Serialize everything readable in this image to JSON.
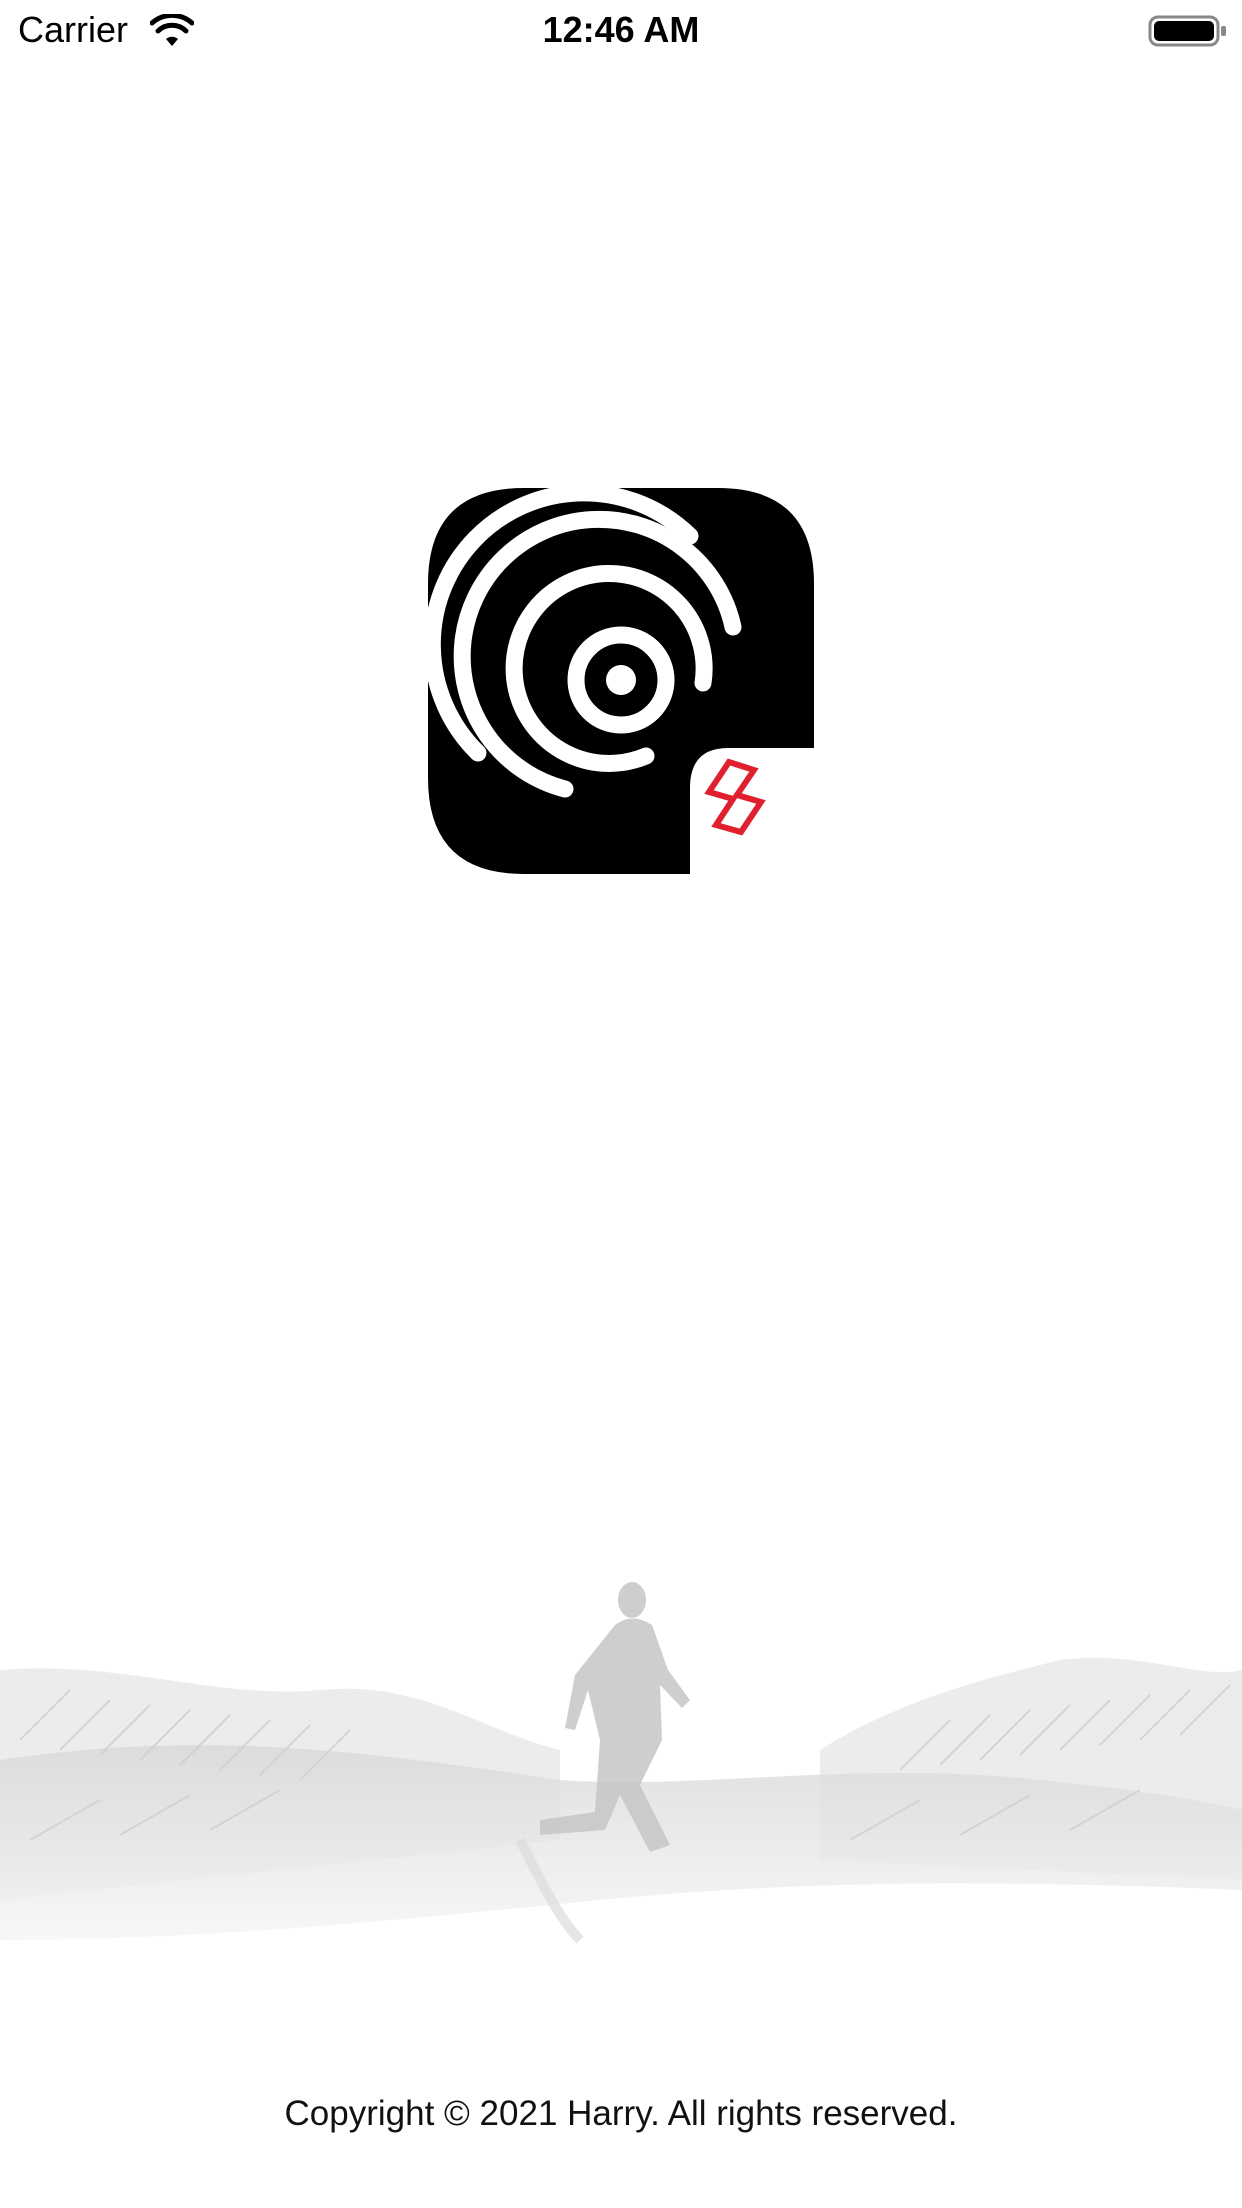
{
  "status_bar": {
    "carrier": "Carrier",
    "time": "12:46 AM",
    "icons": [
      "wifi-icon",
      "battery-icon"
    ]
  },
  "splash": {
    "logo_icon": "app-logo-icon",
    "background_art": "runner-sketch-illustration",
    "copyright": "Copyright © 2021 Harry. All rights reserved."
  },
  "colors": {
    "background": "#ffffff",
    "logo_tile": "#000000",
    "logo_rings": "#ffffff",
    "accent_red": "#e0202e",
    "sketch_gray": "#c8c8c8"
  }
}
